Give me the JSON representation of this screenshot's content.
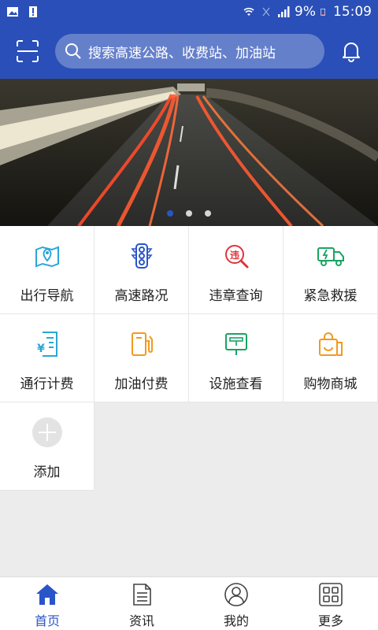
{
  "status_bar": {
    "battery": "9%",
    "time": "15:09"
  },
  "header": {
    "search_placeholder": "搜索高速公路、收费站、加油站"
  },
  "banner": {
    "slides": 3,
    "active_slide": 1
  },
  "grid": {
    "items": [
      {
        "label": "出行导航",
        "icon": "map-pin-icon",
        "color": "#2aa7d8"
      },
      {
        "label": "高速路况",
        "icon": "traffic-light-icon",
        "color": "#2a55c8"
      },
      {
        "label": "违章查询",
        "icon": "violation-search-icon",
        "color": "#e0333a"
      },
      {
        "label": "紧急救援",
        "icon": "rescue-truck-icon",
        "color": "#1aa364"
      },
      {
        "label": "通行计费",
        "icon": "toll-receipt-icon",
        "color": "#2aa7d8"
      },
      {
        "label": "加油付费",
        "icon": "fuel-pump-icon",
        "color": "#f29a1e"
      },
      {
        "label": "设施查看",
        "icon": "facility-sign-icon",
        "color": "#1aa364"
      },
      {
        "label": "购物商城",
        "icon": "shopping-bag-icon",
        "color": "#f29a1e"
      },
      {
        "label": "添加",
        "icon": "add-icon",
        "color": "#d8d8d8"
      }
    ]
  },
  "tabbar": {
    "tabs": [
      {
        "label": "首页",
        "icon": "home-icon",
        "active": true
      },
      {
        "label": "资讯",
        "icon": "news-icon",
        "active": false
      },
      {
        "label": "我的",
        "icon": "user-icon",
        "active": false
      },
      {
        "label": "更多",
        "icon": "grid-more-icon",
        "active": false
      }
    ]
  },
  "colors": {
    "primary": "#2a4fb8",
    "accent": "#2a55c8"
  }
}
